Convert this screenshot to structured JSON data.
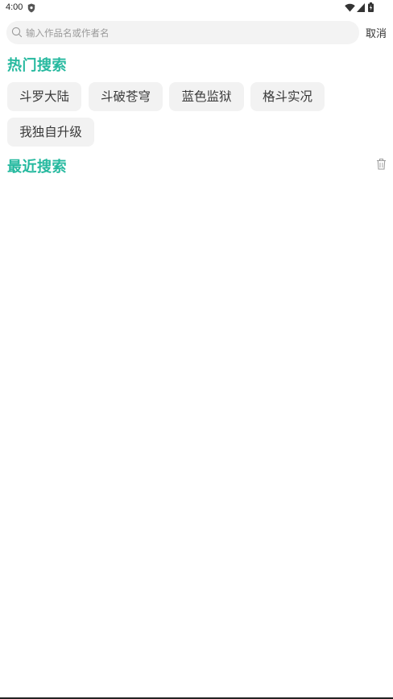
{
  "status_bar": {
    "time": "4:00",
    "icons": [
      "shield-icon",
      "wifi-icon",
      "signal-icon",
      "battery-icon"
    ]
  },
  "search": {
    "placeholder": "输入作品名或作者名",
    "value": "",
    "cancel_label": "取消"
  },
  "hot_search": {
    "title": "热门搜索",
    "tags": [
      "斗罗大陆",
      "斗破苍穹",
      "蓝色监狱",
      "格斗实况",
      "我独自升级"
    ]
  },
  "recent_search": {
    "title": "最近搜索",
    "items": []
  },
  "colors": {
    "accent": "#26b99f",
    "tag_bg": "#f2f2f2",
    "search_bg": "#f3f3f3"
  }
}
